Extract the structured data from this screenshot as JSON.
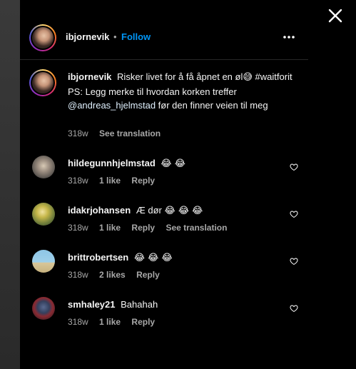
{
  "post": {
    "author": "ibjornevik",
    "follow_label": "Follow",
    "dot": "•",
    "more_icon": "more-horizontal-icon",
    "close_icon": "close-icon"
  },
  "caption": {
    "username": "ibjornevik",
    "text_part1": "Risker livet for å få åpnet en øl",
    "emoji": "😅",
    "text_part2": "#waitforit PS: Legg merke til hvordan korken treffer",
    "mention": "@andreas_hjelmstad",
    "text_part3": "før den finner veien til meg",
    "age": "318w",
    "see_translation": "See translation"
  },
  "comments": [
    {
      "username": "hildegunnhjelmstad",
      "text": "",
      "emojis": "😂 😂",
      "age": "318w",
      "likes": "1 like",
      "reply": "Reply",
      "see_translation": ""
    },
    {
      "username": "idakrjohansen",
      "text": "Æ dør",
      "emojis": "😂 😂 😂",
      "age": "318w",
      "likes": "1 like",
      "reply": "Reply",
      "see_translation": "See translation"
    },
    {
      "username": "brittrobertsen",
      "text": "",
      "emojis": "😂 😂 😂",
      "age": "318w",
      "likes": "2 likes",
      "reply": "Reply",
      "see_translation": ""
    },
    {
      "username": "smhaley21",
      "text": "Bahahah",
      "emojis": "",
      "age": "318w",
      "likes": "1 like",
      "reply": "Reply",
      "see_translation": ""
    }
  ],
  "colors": {
    "follow": "#0095f6",
    "muted": "#a8a8a8",
    "background": "#000000"
  }
}
